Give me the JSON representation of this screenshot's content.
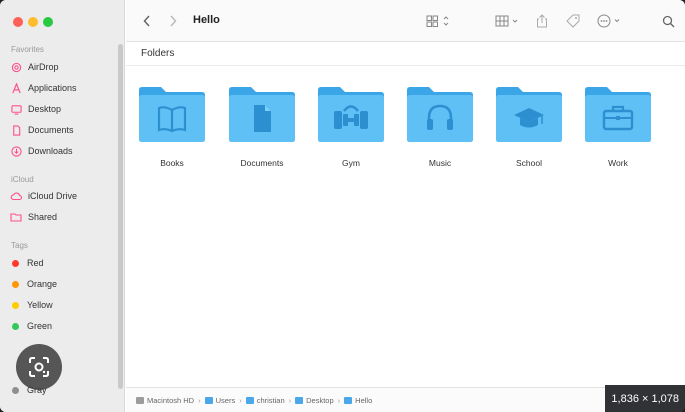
{
  "window": {
    "title": "Hello"
  },
  "sidebar": {
    "favorites_label": "Favorites",
    "favorites": [
      {
        "label": "AirDrop",
        "icon": "airdrop-icon"
      },
      {
        "label": "Applications",
        "icon": "applications-icon"
      },
      {
        "label": "Desktop",
        "icon": "desktop-icon"
      },
      {
        "label": "Documents",
        "icon": "documents-icon"
      },
      {
        "label": "Downloads",
        "icon": "downloads-icon"
      }
    ],
    "icloud_label": "iCloud",
    "icloud": [
      {
        "label": "iCloud Drive",
        "icon": "icloud-icon"
      },
      {
        "label": "Shared",
        "icon": "shared-folder-icon"
      }
    ],
    "tags_label": "Tags",
    "tags": [
      {
        "label": "Red",
        "color": "#ff3b30"
      },
      {
        "label": "Orange",
        "color": "#ff9500"
      },
      {
        "label": "Yellow",
        "color": "#ffcc00"
      },
      {
        "label": "Green",
        "color": "#34c759"
      },
      {
        "label": "Gray",
        "color": "#8e8e93"
      }
    ],
    "accent_color": "#ff4f8b"
  },
  "content": {
    "section_label": "Folders",
    "folders": [
      {
        "label": "Books",
        "icon": "book-icon"
      },
      {
        "label": "Documents",
        "icon": "document-icon"
      },
      {
        "label": "Gym",
        "icon": "dumbbell-icon"
      },
      {
        "label": "Music",
        "icon": "headphones-icon"
      },
      {
        "label": "School",
        "icon": "graduation-cap-icon"
      },
      {
        "label": "Work",
        "icon": "briefcase-icon"
      }
    ],
    "folder_color": "#4cb3ef"
  },
  "pathbar": {
    "segments": [
      "Macintosh HD",
      "Users",
      "christian",
      "Desktop",
      "Hello"
    ]
  },
  "overlay": {
    "dimensions": "1,836 × 1,078"
  }
}
